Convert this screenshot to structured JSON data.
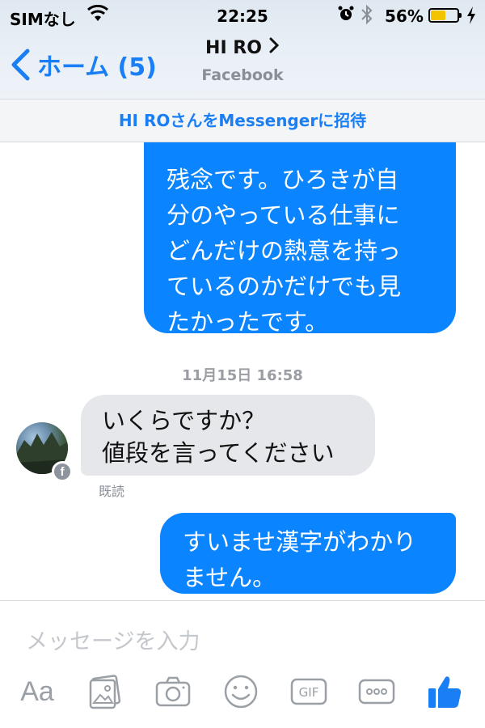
{
  "status_bar": {
    "carrier": "SIMなし",
    "time": "22:25",
    "battery_percent": "56%",
    "battery_level": 0.56,
    "icons": [
      "wifi-icon",
      "alarm-icon",
      "bluetooth-icon",
      "battery-icon",
      "charging-icon"
    ]
  },
  "nav": {
    "back_label": "ホーム (5)",
    "title": "HI RO",
    "subtitle": "Facebook"
  },
  "invite": {
    "text": "HI ROさんをMessengerに招待"
  },
  "messages": {
    "outgoing_1_lines": [
      "残念です。ひろきが自",
      "分のやっている仕事に",
      "どんだけの熱意を持っ",
      "ているのかだけでも見",
      "たかったです。"
    ],
    "timestamp": "11月15日 16:58",
    "incoming_1_lines": [
      "いくらですか？",
      "値段を言ってください"
    ],
    "read_receipt": "既読",
    "outgoing_2_lines": [
      "すいませ漢字がわかり",
      "ません。"
    ]
  },
  "composer": {
    "placeholder": "メッセージを入力",
    "aa_label": "Aa",
    "toolbar_icons": [
      "text-format-icon",
      "photo-icon",
      "camera-icon",
      "emoji-icon",
      "gif-icon",
      "more-icon",
      "like-icon"
    ]
  },
  "colors": {
    "accent": "#1a7ff5",
    "outgoing_bubble": "#0a84ff",
    "incoming_bubble": "#e6e7eb",
    "battery": "#f2c400"
  }
}
